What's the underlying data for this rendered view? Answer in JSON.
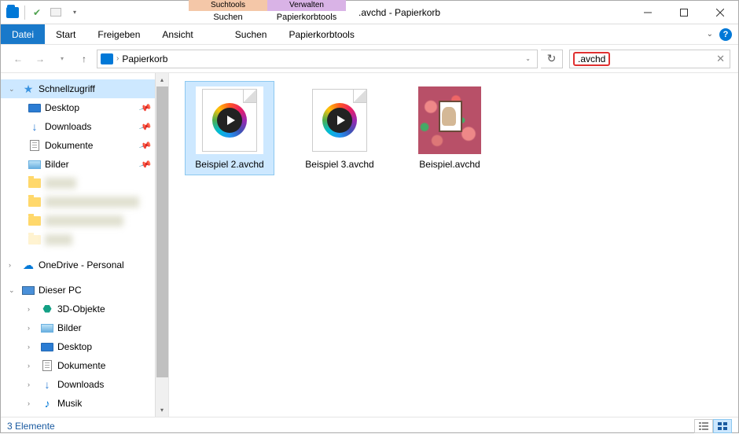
{
  "title": ".avchd - Papierkorb",
  "context_tabs": [
    {
      "header": "Suchtools",
      "body": "Suchen"
    },
    {
      "header": "Verwalten",
      "body": "Papierkorbtools"
    }
  ],
  "ribbon": {
    "file": "Datei",
    "tabs": [
      "Start",
      "Freigeben",
      "Ansicht"
    ]
  },
  "nav": {
    "location": "Papierkorb",
    "search_value": ".avchd"
  },
  "sidebar": {
    "quick_access": "Schnellzugriff",
    "desktop": "Desktop",
    "downloads": "Downloads",
    "documents": "Dokumente",
    "pictures": "Bilder",
    "onedrive": "OneDrive - Personal",
    "this_pc": "Dieser PC",
    "objects3d": "3D-Objekte",
    "pc_pictures": "Bilder",
    "pc_desktop": "Desktop",
    "pc_documents": "Dokumente",
    "pc_downloads": "Downloads",
    "pc_music": "Musik"
  },
  "files": [
    {
      "name": "Beispiel 2.avchd",
      "type": "video"
    },
    {
      "name": "Beispiel 3.avchd",
      "type": "video"
    },
    {
      "name": "Beispiel.avchd",
      "type": "image"
    }
  ],
  "status": "3 Elemente"
}
